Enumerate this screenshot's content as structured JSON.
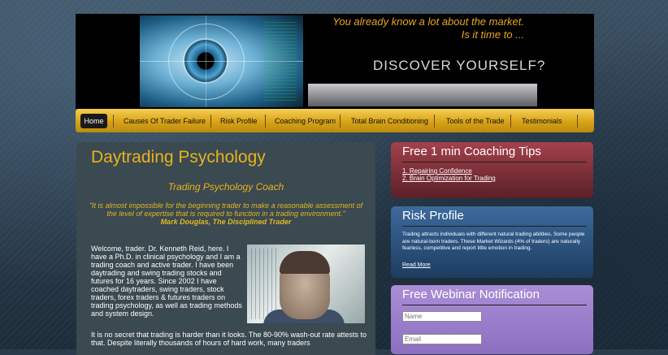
{
  "header": {
    "tagline_line1": "You already know a lot about the market.",
    "tagline_line2": "Is it time to ...",
    "headline": "DISCOVER YOURSELF?"
  },
  "nav": {
    "items": [
      {
        "label": "Home",
        "active": true
      },
      {
        "label": "Causes Of Trader Failure"
      },
      {
        "label": "Risk Profile"
      },
      {
        "label": "Coaching Program"
      },
      {
        "label": "Total Brain Conditioning"
      },
      {
        "label": "Tools of the Trade"
      },
      {
        "label": "Testimonials"
      }
    ]
  },
  "main": {
    "title": "Daytrading Psychology",
    "subtitle": "Trading Psychology Coach",
    "quote": "\"It is almost impossible for the beginning trader to make a reasonable assessment of the level of expertise that is required to function in a trading environment.\"",
    "quote_author": "Mark Douglas, The Disciplined Trader",
    "intro": "Welcome, trader. Dr. Kenneth Reid, here. I have a Ph.D. in clinical psychology and I am a trading coach and active trader. I have been daytrading and swing trading stocks and futures for 16 years. Since 2002 I have coached daytraders, swing traders, stock traders, forex traders & futures traders on trading psychology, as well as trading methods and system design.",
    "para2": "It is no secret that trading is harder than it looks. The 80-90% wash-out rate attests to that.  Despite literally thousands of hours of hard work, many traders"
  },
  "widgets": {
    "coaching_tips": {
      "title": "Free 1 min Coaching Tips",
      "links": [
        "1. Repairing Confidence",
        "2. Brain Optimization for Trading"
      ]
    },
    "risk_profile": {
      "title": "Risk Profile",
      "text": "Trading attracts individuals with different natural trading abilities. Some people are natural-born traders. These Market Wizards (4% of traders) are naturally fearless, competitive and report little emotion in trading.",
      "read_more": "Read More"
    },
    "webinar": {
      "title": "Free Webinar Notification",
      "name_placeholder": "Name",
      "email_placeholder": "Email"
    }
  },
  "colors": {
    "accent_gold": "#e8b41c",
    "nav_gold": "#d9a317",
    "widget_red": "#a3414b",
    "widget_blue": "#3d6a9d",
    "widget_purple": "#a98ed6"
  }
}
